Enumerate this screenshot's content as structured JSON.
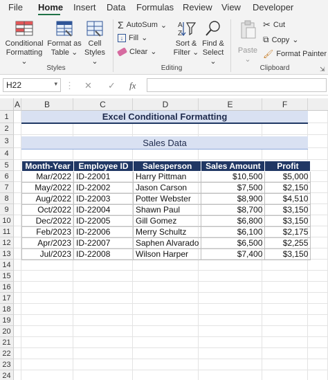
{
  "tabs": [
    "File",
    "Home",
    "Insert",
    "Data",
    "Formulas",
    "Review",
    "View",
    "Developer"
  ],
  "ribbon": {
    "styles": {
      "conditional_formatting": [
        "Conditional",
        "Formatting"
      ],
      "format_as_table": [
        "Format as",
        "Table"
      ],
      "cell_styles": [
        "Cell",
        "Styles"
      ],
      "label": "Styles"
    },
    "editing": {
      "autosum": "AutoSum",
      "fill": "Fill",
      "clear": "Clear",
      "sort_filter": [
        "Sort &",
        "Filter"
      ],
      "find_select": [
        "Find &",
        "Select"
      ],
      "label": "Editing"
    },
    "clipboard": {
      "paste": "Paste",
      "cut": "Cut",
      "copy": "Copy",
      "format_painter": "Format Painter",
      "label": "Clipboard"
    }
  },
  "formula_bar": {
    "name_box": "H22",
    "fx": "fx",
    "formula": ""
  },
  "columns": [
    "A",
    "B",
    "C",
    "D",
    "E",
    "F"
  ],
  "rows": [
    "1",
    "2",
    "3",
    "4",
    "5",
    "6",
    "7",
    "8",
    "9",
    "10",
    "11",
    "12",
    "13",
    "14",
    "15",
    "16",
    "17",
    "18",
    "19",
    "20",
    "21",
    "22",
    "23",
    "24"
  ],
  "sheet": {
    "title": "Excel Conditional Formatting",
    "subtitle": "Sales Data",
    "headers": [
      "Month-Year",
      "Employee ID",
      "Salesperson",
      "Sales Amount",
      "Profit"
    ],
    "records": [
      [
        "Mar/2022",
        "ID-22001",
        "Harry Pittman",
        "$10,500",
        "$5,000"
      ],
      [
        "May/2022",
        "ID-22002",
        "Jason Carson",
        "$7,500",
        "$2,150"
      ],
      [
        "Aug/2022",
        "ID-22003",
        "Potter Webster",
        "$8,900",
        "$4,510"
      ],
      [
        "Oct/2022",
        "ID-22004",
        "Shawn Paul",
        "$8,700",
        "$3,150"
      ],
      [
        "Dec/2022",
        "ID-22005",
        "Gill Gomez",
        "$6,800",
        "$3,150"
      ],
      [
        "Feb/2023",
        "ID-22006",
        "Merry Schultz",
        "$6,100",
        "$2,175"
      ],
      [
        "Apr/2023",
        "ID-22007",
        "Saphen Alvarado",
        "$6,500",
        "$2,255"
      ],
      [
        "Jul/2023",
        "ID-22008",
        "Wilson Harper",
        "$7,400",
        "$3,150"
      ]
    ]
  },
  "colors": {
    "accent": "#217346",
    "header_fill": "#203764",
    "banner_fill": "#d9e1f2"
  }
}
